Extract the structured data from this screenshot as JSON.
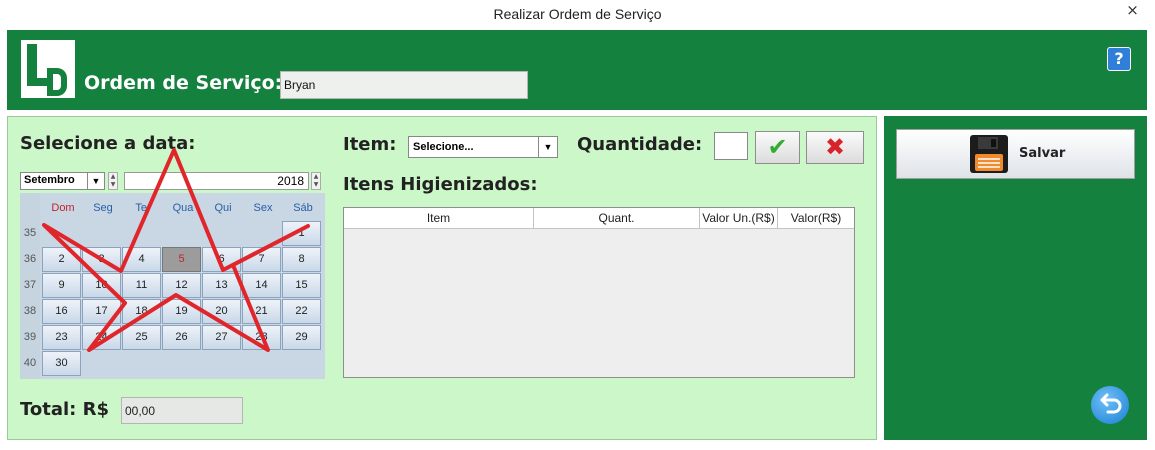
{
  "window": {
    "title": "Realizar Ordem de Serviço",
    "close_glyph": "×"
  },
  "header": {
    "logo_text": "LD",
    "label": "Ordem de Serviço:",
    "client_value": "Bryan",
    "help_glyph": "?"
  },
  "calendar": {
    "heading": "Selecione a data:",
    "month": "Setembro",
    "year": "2018",
    "day_headers": [
      "Dom",
      "Seg",
      "Ter",
      "Qua",
      "Qui",
      "Sex",
      "Sáb"
    ],
    "week_numbers": [
      "35",
      "36",
      "37",
      "38",
      "39",
      "40"
    ],
    "days": [
      "1",
      "2",
      "3",
      "4",
      "5",
      "6",
      "7",
      "8",
      "9",
      "10",
      "11",
      "12",
      "13",
      "14",
      "15",
      "16",
      "17",
      "18",
      "19",
      "20",
      "21",
      "22",
      "23",
      "24",
      "25",
      "26",
      "27",
      "28",
      "29",
      "30"
    ],
    "selected_day": "5"
  },
  "item": {
    "label": "Item:",
    "select_value": "Selecione...",
    "quantity_label": "Quantidade:",
    "quantity_value": "",
    "confirm_glyph": "✔",
    "cancel_glyph": "✖"
  },
  "table": {
    "heading": "Itens Higienizados:",
    "columns": [
      "Item",
      "Quant.",
      "Valor Un.(R$)",
      "Valor(R$)"
    ],
    "rows": []
  },
  "total": {
    "label": "Total: R$",
    "value": "00,00"
  },
  "sidebar": {
    "save_label": "Salvar",
    "back_glyph": "↺"
  },
  "colors": {
    "header_green": "#14813f",
    "panel_light_green": "#ccf7c8",
    "annotation_red": "#e0262b"
  }
}
